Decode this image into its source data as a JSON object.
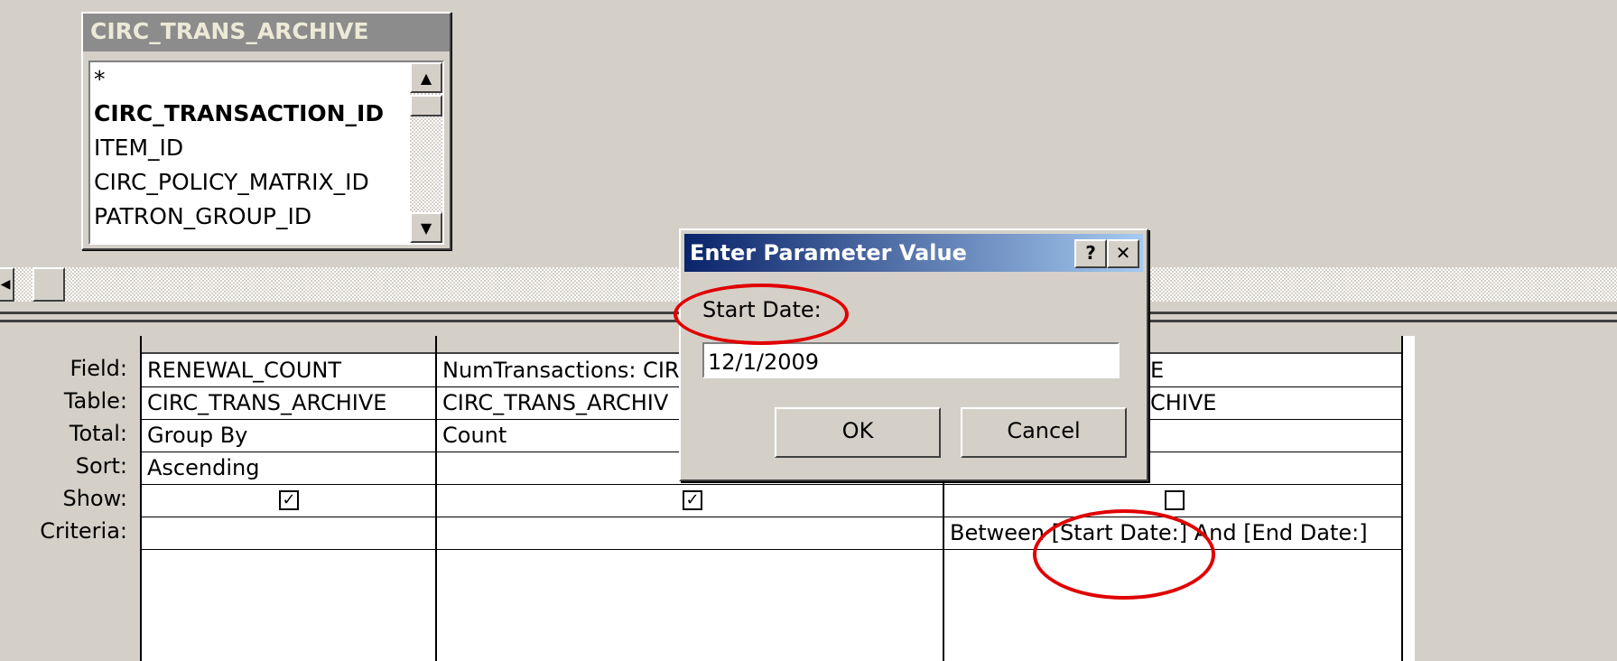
{
  "table_window": {
    "title": "CIRC_TRANS_ARCHIVE",
    "fields": [
      "*",
      "CIRC_TRANSACTION_ID",
      "ITEM_ID",
      "CIRC_POLICY_MATRIX_ID",
      "PATRON_GROUP_ID"
    ]
  },
  "grid": {
    "row_labels": [
      "Field:",
      "Table:",
      "Total:",
      "Sort:",
      "Show:",
      "Criteria:"
    ],
    "columns": [
      {
        "field": "RENEWAL_COUNT",
        "table": "CIRC_TRANS_ARCHIVE",
        "total": "Group By",
        "sort": "Ascending",
        "show": true,
        "criteria": ""
      },
      {
        "field": "NumTransactions: CIR",
        "table": "CIRC_TRANS_ARCHIV",
        "total": "Count",
        "sort": "",
        "show": true,
        "criteria": ""
      },
      {
        "field": "E",
        "table": "CHIVE",
        "total": "",
        "sort": "",
        "show": false,
        "criteria": "Between [Start Date:] And [End Date:]"
      }
    ],
    "check_mark": "✓"
  },
  "dialog": {
    "title": "Enter Parameter Value",
    "help_label": "?",
    "close_label": "✕",
    "prompt": "Start Date:",
    "input_value": "12/1/2009",
    "ok_label": "OK",
    "cancel_label": "Cancel"
  },
  "annotation_color": "#e00000",
  "icons": {
    "scroll_up": "▲",
    "scroll_down": "▼",
    "scroll_left": "◀"
  }
}
